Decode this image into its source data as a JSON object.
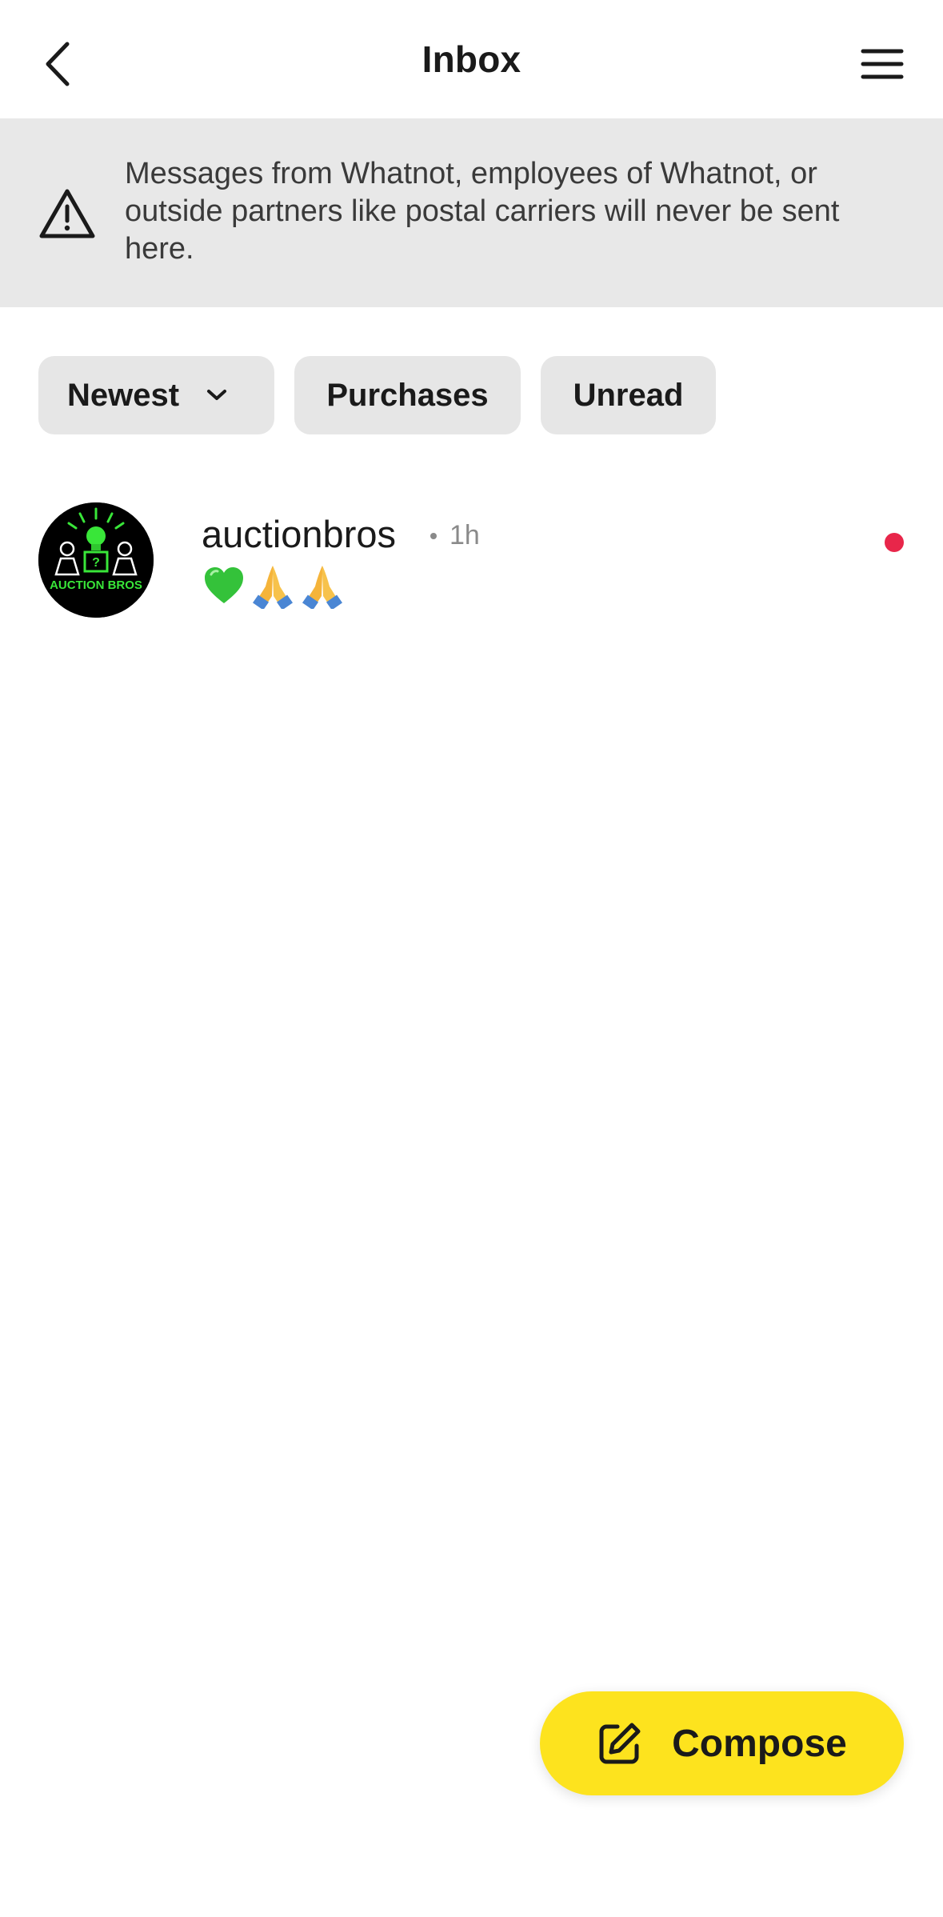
{
  "header": {
    "title": "Inbox",
    "back_icon": "chevron-left-icon",
    "menu_icon": "hamburger-menu-icon"
  },
  "banner": {
    "icon": "warning-triangle-icon",
    "text": "Messages from Whatnot, employees of Whatnot, or outside partners like postal carriers will never be sent here."
  },
  "filters": {
    "sort_label": "Newest",
    "sort_icon": "chevron-down-icon",
    "purchases_label": "Purchases",
    "unread_label": "Unread"
  },
  "conversations": [
    {
      "name": "auctionbros",
      "time": "1h",
      "preview_emojis": [
        "green-heart",
        "folded-hands",
        "folded-hands"
      ],
      "unread": true,
      "avatar_text": "AUCTION BROS"
    }
  ],
  "compose": {
    "label": "Compose",
    "icon": "edit-pencil-icon"
  },
  "colors": {
    "compose_bg": "#fde31e",
    "unread_dot": "#e8264a",
    "banner_bg": "#e8e8e8",
    "chip_bg": "#e6e6e6"
  }
}
